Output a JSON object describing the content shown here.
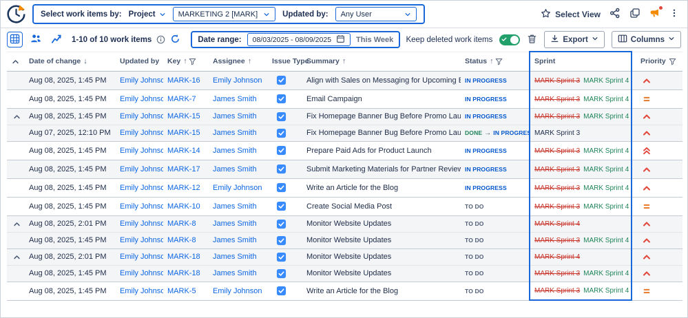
{
  "filter_bar": {
    "select_work_items_label": "Select work items by:",
    "by_field": "Project",
    "project_value": "MARKETING 2 [MARK]",
    "updated_by_label": "Updated by:",
    "user_value": "Any User"
  },
  "top_actions": {
    "select_view": "Select View"
  },
  "toolbar": {
    "count": "1-10 of 10 work items",
    "date_range_label": "Date range:",
    "date_range_value": "08/03/2025 - 08/09/2025",
    "date_range_hint": "This Week",
    "keep_deleted_label": "Keep deleted work items",
    "export_label": "Export",
    "columns_label": "Columns"
  },
  "colors": {
    "accent": "#1868DB",
    "link": "#0C66E4",
    "status_in_progress": "#0055CC",
    "status_to_do": "#505F79",
    "status_done": "#1F845A",
    "sprint_removed": "#C9372C",
    "sprint_added": "#1F845A",
    "toggle_on": "#22A06B",
    "priority_high": "#E2483D",
    "priority_medium": "#E97F33"
  },
  "table": {
    "columns": [
      {
        "id": "expander",
        "label": ""
      },
      {
        "id": "date",
        "label": "Date of change",
        "sort": "desc"
      },
      {
        "id": "updated-by",
        "label": "Updated by"
      },
      {
        "id": "key",
        "label": "Key",
        "sort": "asc",
        "filter": true
      },
      {
        "id": "assignee",
        "label": "Assignee",
        "sort": "asc"
      },
      {
        "id": "issue-type",
        "label": "Issue Type"
      },
      {
        "id": "summary",
        "label": "Summary",
        "sort": "asc"
      },
      {
        "id": "status",
        "label": "Status",
        "sort": "asc",
        "filter": true
      },
      {
        "id": "sprint",
        "label": "Sprint",
        "highlighted": true
      },
      {
        "id": "priority",
        "label": "Priority",
        "filter": true
      }
    ],
    "rows": [
      {
        "group": "single",
        "shaded": true,
        "date": "Aug 08, 2025, 1:45 PM",
        "updated_by": "Emily Johnson",
        "key": "MARK-16",
        "assignee": "Emily Johnson",
        "issue_type": "Task",
        "summary": "Align with Sales on Messaging for Upcoming Event",
        "status": [
          "IN PROGRESS"
        ],
        "sprint": {
          "removed": "MARK Sprint 3",
          "added": "MARK Sprint 4"
        },
        "priority": "high"
      },
      {
        "group": "single",
        "shaded": false,
        "date": "Aug 08, 2025, 1:45 PM",
        "updated_by": "Emily Johnson",
        "key": "MARK-7",
        "assignee": "James Smith",
        "issue_type": "Task",
        "summary": "Email Campaign",
        "status": [
          "IN PROGRESS"
        ],
        "sprint": {
          "removed": "MARK Sprint 3",
          "added": "MARK Sprint 4"
        },
        "priority": "medium"
      },
      {
        "group": "parent",
        "shaded": true,
        "date": "Aug 08, 2025, 1:45 PM",
        "updated_by": "Emily Johnson",
        "key": "MARK-15",
        "assignee": "James Smith",
        "issue_type": "Task",
        "summary": "Fix Homepage Banner Bug Before Promo Launch",
        "status": [
          "IN PROGRESS"
        ],
        "sprint": {
          "removed": "MARK Sprint 3",
          "added": "MARK Sprint 4"
        },
        "priority": "high"
      },
      {
        "group": "child",
        "shaded": true,
        "date": "Aug 07, 2025, 12:10 PM",
        "updated_by": "Emily Johnson",
        "key": "MARK-15",
        "assignee": "James Smith",
        "issue_type": "Task",
        "summary": "Fix Homepage Banner Bug Before Promo Launch",
        "status": [
          "DONE",
          "IN PROGRESS"
        ],
        "sprint": {
          "current": "MARK Sprint 3"
        },
        "priority": "high"
      },
      {
        "group": "single",
        "shaded": false,
        "date": "Aug 08, 2025, 1:45 PM",
        "updated_by": "Emily Johnson",
        "key": "MARK-14",
        "assignee": "James Smith",
        "issue_type": "Task",
        "summary": "Prepare Paid Ads for Product Launch",
        "status": [
          "IN PROGRESS"
        ],
        "sprint": {
          "removed": "MARK Sprint 3",
          "added": "MARK Sprint 4"
        },
        "priority": "highest"
      },
      {
        "group": "single",
        "shaded": true,
        "date": "Aug 08, 2025, 1:45 PM",
        "updated_by": "Emily Johnson",
        "key": "MARK-17",
        "assignee": "James Smith",
        "issue_type": "Task",
        "summary": "Submit Marketing Materials for Partner Review",
        "status": [
          "IN PROGRESS"
        ],
        "sprint": {
          "removed": "MARK Sprint 3",
          "added": "MARK Sprint 4"
        },
        "priority": "high"
      },
      {
        "group": "single",
        "shaded": false,
        "date": "Aug 08, 2025, 1:45 PM",
        "updated_by": "Emily Johnson",
        "key": "MARK-12",
        "assignee": "Emily Johnson",
        "issue_type": "Task",
        "summary": "Write an Article for the Blog",
        "status": [
          "IN PROGRESS"
        ],
        "sprint": {
          "removed": "MARK Sprint 3",
          "added": "MARK Sprint 4"
        },
        "priority": "high"
      },
      {
        "group": "single",
        "shaded": false,
        "date": "Aug 08, 2025, 1:45 PM",
        "updated_by": "Emily Johnson",
        "key": "MARK-10",
        "assignee": "James Smith",
        "issue_type": "Task",
        "summary": "Create Social Media Post",
        "status": [
          "TO DO"
        ],
        "sprint": {
          "removed": "MARK Sprint 3",
          "added": "MARK Sprint 4"
        },
        "priority": "medium"
      },
      {
        "group": "parent",
        "shaded": true,
        "date": "Aug 08, 2025, 2:01 PM",
        "updated_by": "Emily Johnson",
        "key": "MARK-8",
        "assignee": "James Smith",
        "issue_type": "Task",
        "summary": "Monitor Website Updates",
        "status": [
          "TO DO"
        ],
        "sprint": {
          "removed": "MARK Sprint 4"
        },
        "priority": "high"
      },
      {
        "group": "child",
        "shaded": true,
        "date": "Aug 08, 2025, 1:45 PM",
        "updated_by": "Emily Johnson",
        "key": "MARK-8",
        "assignee": "James Smith",
        "issue_type": "Task",
        "summary": "Monitor Website Updates",
        "status": [
          "TO DO"
        ],
        "sprint": {
          "removed": "MARK Sprint 3",
          "added": "MARK Sprint 4"
        },
        "priority": "high"
      },
      {
        "group": "parent",
        "shaded": true,
        "date": "Aug 08, 2025, 2:01 PM",
        "updated_by": "Emily Johnson",
        "key": "MARK-18",
        "assignee": "James Smith",
        "issue_type": "Task",
        "summary": "Monitor Website Updates",
        "status": [
          "TO DO"
        ],
        "sprint": {
          "removed": "MARK Sprint 4"
        },
        "priority": "high"
      },
      {
        "group": "child",
        "shaded": true,
        "date": "Aug 08, 2025, 1:45 PM",
        "updated_by": "Emily Johnson",
        "key": "MARK-18",
        "assignee": "James Smith",
        "issue_type": "Task",
        "summary": "Monitor Website Updates",
        "status": [
          "TO DO"
        ],
        "sprint": {
          "removed": "MARK Sprint 3",
          "added": "MARK Sprint 4"
        },
        "priority": "high"
      },
      {
        "group": "single",
        "shaded": false,
        "date": "Aug 08, 2025, 1:45 PM",
        "updated_by": "Emily Johnson",
        "key": "MARK-5",
        "assignee": "Emily Johnson",
        "issue_type": "Task",
        "summary": "Write an Article for the Blog",
        "status": [
          "TO DO"
        ],
        "sprint": {
          "removed": "MARK Sprint 3",
          "added": "MARK Sprint 4"
        },
        "priority": "medium"
      }
    ]
  }
}
